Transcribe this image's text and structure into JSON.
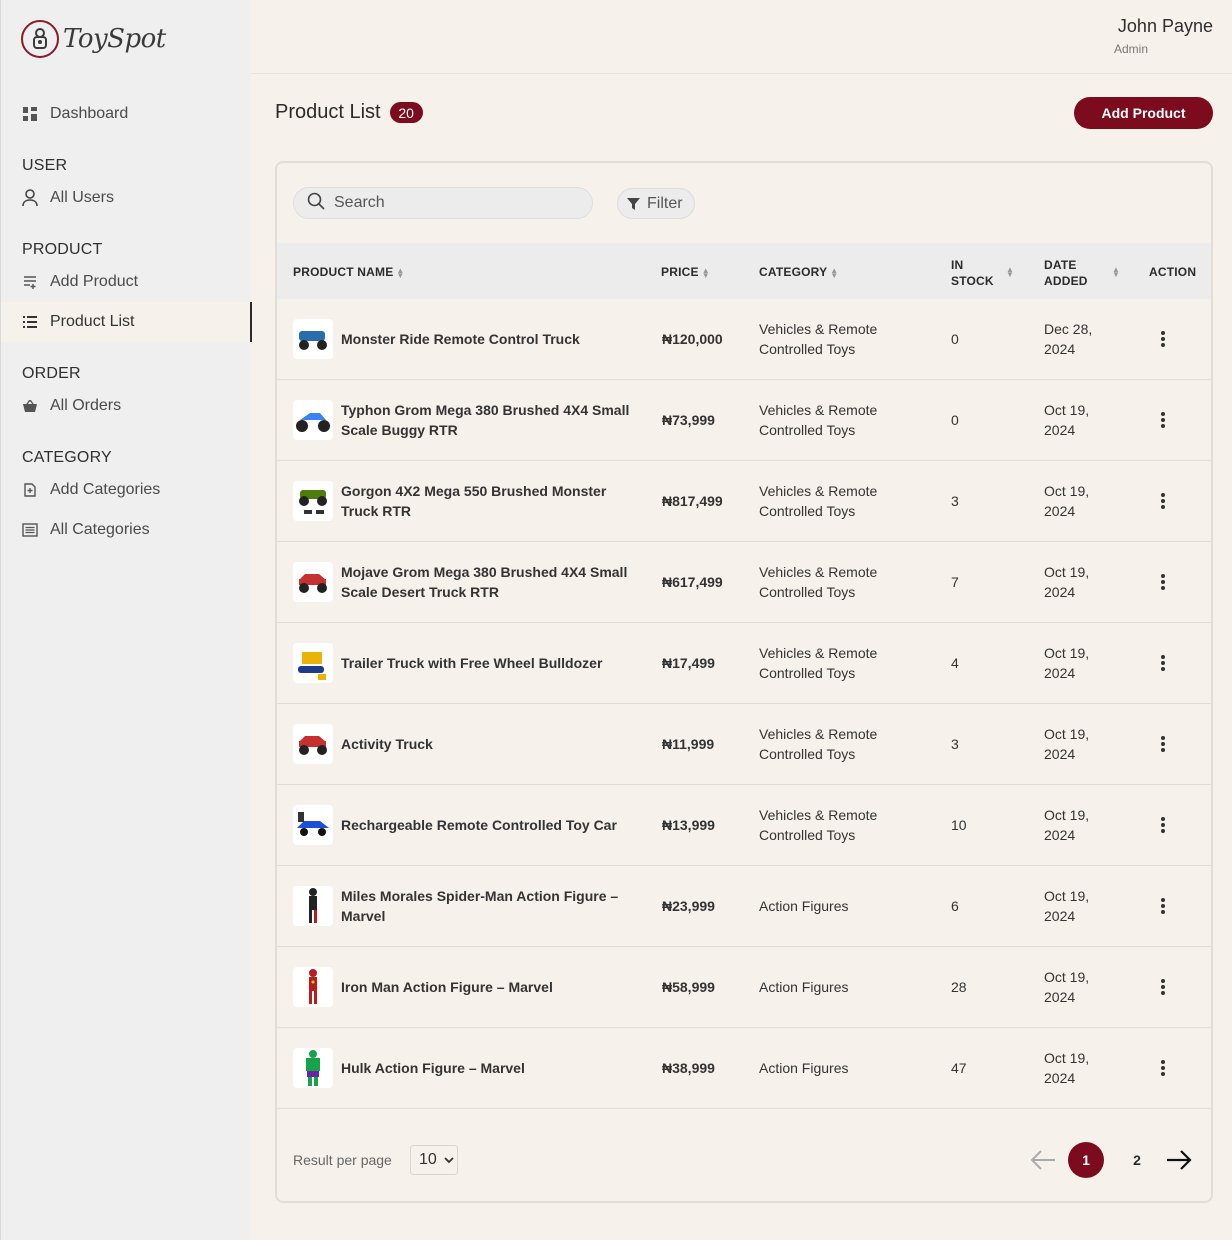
{
  "brand": {
    "name": "ToySpot",
    "accent": "#7c0b1e"
  },
  "user": {
    "name": "John Payne",
    "role": "Admin"
  },
  "sidebar": {
    "dashboard": "Dashboard",
    "sections": [
      {
        "heading": "USER",
        "items": [
          "All Users"
        ]
      },
      {
        "heading": "PRODUCT",
        "items": [
          "Add Product",
          "Product List"
        ]
      },
      {
        "heading": "ORDER",
        "items": [
          "All Orders"
        ]
      },
      {
        "heading": "CATEGORY",
        "items": [
          "Add Categories",
          "All Categories"
        ]
      }
    ],
    "active": "Product List"
  },
  "page": {
    "title": "Product List",
    "count": "20",
    "add_button": "Add Product"
  },
  "toolbar": {
    "search_placeholder": "Search",
    "filter_label": "Filter"
  },
  "table": {
    "headers": {
      "name": "PRODUCT NAME",
      "price": "PRICE",
      "category": "CATEGORY",
      "stock_1": "IN",
      "stock_2": "STOCK",
      "date_1": "DATE",
      "date_2": "ADDED",
      "action": "ACTION"
    },
    "rows": [
      {
        "name": "Monster Ride Remote Control Truck",
        "price": "₦120,000",
        "category": "Vehicles & Remote Controlled Toys",
        "stock": "0",
        "date": "Dec 28, 2024",
        "thumb": "truck-blue"
      },
      {
        "name": "Typhon Grom Mega 380 Brushed 4X4 Small Scale Buggy RTR",
        "price": "₦73,999",
        "category": "Vehicles & Remote Controlled Toys",
        "stock": "0",
        "date": "Oct 19, 2024",
        "thumb": "buggy-blue"
      },
      {
        "name": "Gorgon 4X2 Mega 550 Brushed Monster Truck RTR",
        "price": "₦817,499",
        "category": "Vehicles & Remote Controlled Toys",
        "stock": "3",
        "date": "Oct 19, 2024",
        "thumb": "truck-green"
      },
      {
        "name": "Mojave Grom Mega 380 Brushed 4X4 Small Scale Desert Truck RTR",
        "price": "₦617,499",
        "category": "Vehicles & Remote Controlled Toys",
        "stock": "7",
        "date": "Oct 19, 2024",
        "thumb": "truck-red"
      },
      {
        "name": "Trailer Truck with Free Wheel Bulldozer",
        "price": "₦17,499",
        "category": "Vehicles & Remote Controlled Toys",
        "stock": "4",
        "date": "Oct 19, 2024",
        "thumb": "bulldozer-yellow"
      },
      {
        "name": "Activity Truck",
        "price": "₦11,999",
        "category": "Vehicles & Remote Controlled Toys",
        "stock": "3",
        "date": "Oct 19, 2024",
        "thumb": "truck-red"
      },
      {
        "name": "Rechargeable Remote Controlled Toy Car",
        "price": "₦13,999",
        "category": "Vehicles & Remote Controlled Toys",
        "stock": "10",
        "date": "Oct 19, 2024",
        "thumb": "car-blue"
      },
      {
        "name": "Miles Morales Spider-Man Action Figure – Marvel",
        "price": "₦23,999",
        "category": "Action Figures",
        "stock": "6",
        "date": "Oct 19, 2024",
        "thumb": "figure-black"
      },
      {
        "name": "Iron Man Action Figure – Marvel",
        "price": "₦58,999",
        "category": "Action Figures",
        "stock": "28",
        "date": "Oct 19, 2024",
        "thumb": "figure-red"
      },
      {
        "name": "Hulk Action Figure – Marvel",
        "price": "₦38,999",
        "category": "Action Figures",
        "stock": "47",
        "date": "Oct 19, 2024",
        "thumb": "figure-green"
      }
    ]
  },
  "pagination": {
    "per_page_label": "Result per page",
    "per_page_value": "10",
    "pages": [
      "1",
      "2"
    ],
    "current": "1"
  }
}
